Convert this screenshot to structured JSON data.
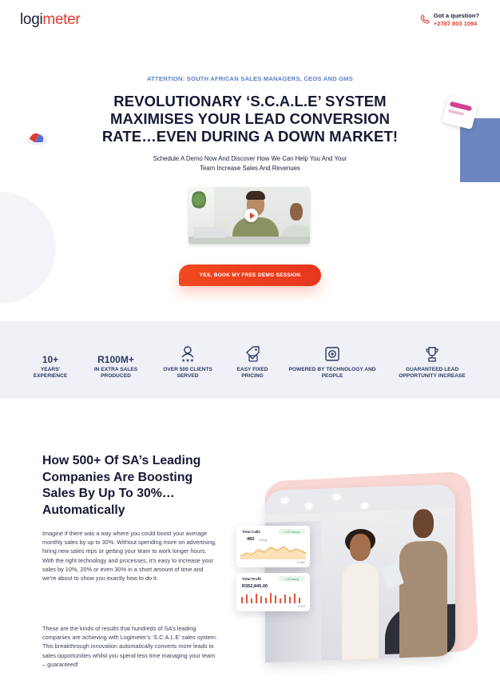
{
  "header": {
    "logo_prefix": "logi",
    "logo_suffix": "meter",
    "contact_question": "Got a question?",
    "contact_number": "+2787 803 1094"
  },
  "hero": {
    "attention": "ATTENTION: SOUTH AFRICAN SALES MANAGERS, CEOS AND GMS",
    "headline": "REVOLUTIONARY ‘S.C.A.L.E’ SYSTEM MAXIMISES YOUR LEAD CONVERSION RATE…EVEN DURING A DOWN MARKET!",
    "subhead": "Schedule A Demo Now And Discover How We Can Help You And Your Team Increase Sales And Revenues",
    "cta_label": "YES, BOOK MY FREE DEMO SESSION"
  },
  "stats": [
    {
      "big": "10+",
      "label": "YEARS' EXPERIENCE"
    },
    {
      "big": "R100M+",
      "label": "IN EXTRA SALES PRODUCED"
    },
    {
      "icon": "team-stars-icon",
      "label": "OVER 500 CLIENTS SERVED"
    },
    {
      "icon": "price-tag-icon",
      "label": "EASY FIXED PRICING"
    },
    {
      "icon": "tech-chip-icon",
      "label": "POWERED BY TECHNOLOGY AND PEOPLE"
    },
    {
      "icon": "trophy-icon",
      "label": "GUARANTEED LEAD OPPORTUNITY INCREASE"
    }
  ],
  "section2": {
    "title": "How 500+ Of SA’s Leading Companies Are Boosting Sales By Up To 30%… Automatically",
    "para1": "Imagine if there was a way where you could boost your average monthly sales by up to 30%. Without spending more on advertising, hiring new sales reps or getting your team to work longer hours.  With the right technology and processes, it’s easy to increase your sales by 10%, 20% or even 30% in a short amount of time and we’re about to show you exactly how to do it.",
    "para2": "These are the kinds of results that hundreds of SA’s leading companies are achieving with Logimeter’s ‘S.C.A.L.E’ sales system. This breakthrough innovation automatically converts more leads to sales opportunities whilst you spend less time managing your team – guaranteed!"
  },
  "cards": {
    "card1": {
      "title": "Total Calls",
      "value": "482",
      "sub": "Today",
      "pill": "+ 120 Hourly",
      "foot": "11,989"
    },
    "card2": {
      "title": "Total Profit",
      "value": "R352,845.00",
      "pill": "+ 40 Hourly",
      "foot": "8,119"
    }
  },
  "colors": {
    "accent": "#e63b2e",
    "navy": "#161a35",
    "attention_blue": "#5b7fc8",
    "stats_bg": "#f0f1f7",
    "stats_text": "#2b3a63"
  }
}
